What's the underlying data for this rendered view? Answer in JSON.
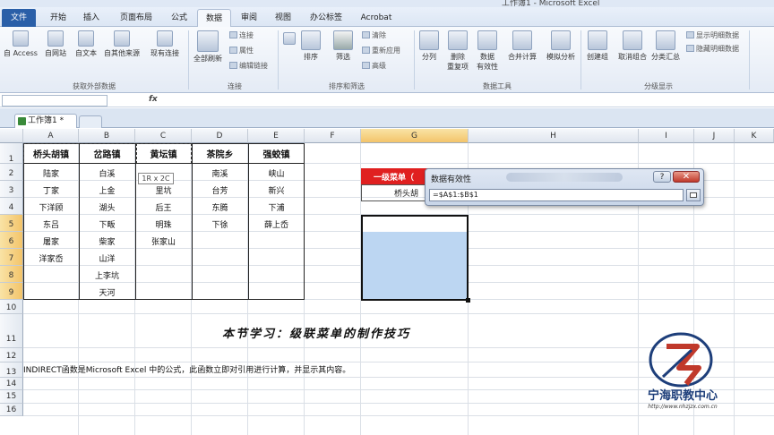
{
  "window": {
    "title": "工作簿1 - Microsoft Excel"
  },
  "tabs": [
    "文件",
    "开始",
    "插入",
    "页面布局",
    "公式",
    "数据",
    "审阅",
    "视图",
    "办公标签",
    "Acrobat"
  ],
  "ribbon": {
    "get_external": {
      "access": "自 Access",
      "web": "自网站",
      "text": "自文本",
      "other": "自其他来源",
      "existing": "现有连接",
      "label": "获取外部数据"
    },
    "connections": {
      "refresh_all": "全部刷新",
      "connections": "连接",
      "properties": "属性",
      "edit_links": "编辑链接",
      "label": "连接"
    },
    "sort_filter": {
      "sort_az": "A↓Z",
      "sort": "排序",
      "filter": "筛选",
      "clear": "清除",
      "reapply": "重新应用",
      "advanced": "高级",
      "label": "排序和筛选"
    },
    "data_tools": {
      "text_to_columns": "分列",
      "remove_dup_1": "删除",
      "remove_dup_2": "重复项",
      "validation_1": "数据",
      "validation_2": "有效性",
      "consolidate": "合并计算",
      "what_if": "模拟分析",
      "label": "数据工具"
    },
    "outline": {
      "group": "创建组",
      "ungroup": "取消组合",
      "subtotal": "分类汇总",
      "show_detail": "显示明细数据",
      "hide_detail": "隐藏明细数据",
      "label": "分级显示"
    }
  },
  "workbook_tab": "工作簿1 *",
  "formula_bar": {
    "fx": "fx",
    "name": ""
  },
  "columns": [
    "A",
    "B",
    "C",
    "D",
    "E",
    "F",
    "G",
    "H",
    "I",
    "J",
    "K"
  ],
  "rows": [
    "1",
    "2",
    "3",
    "4",
    "5",
    "6",
    "7",
    "8",
    "9",
    "10",
    "11",
    "12",
    "13",
    "14",
    "15",
    "16"
  ],
  "table": {
    "headers": [
      "桥头胡镇",
      "岔路镇",
      "黄坛镇",
      "茶院乡",
      "强蛟镇"
    ],
    "col_a": [
      "陆家",
      "丁家",
      "下洋顾",
      "东吕",
      "屠家",
      "洋家岙"
    ],
    "col_b": [
      "白溪",
      "上金",
      "湖头",
      "下畈",
      "柴家",
      "山洋",
      "上李坑",
      "天河"
    ],
    "col_c": [
      "",
      "里坑",
      "后王",
      "明珠",
      "张家山"
    ],
    "col_d": [
      "南溪",
      "台芳",
      "东腾",
      "下徐"
    ],
    "col_e": [
      "峡山",
      "新兴",
      "下浦",
      "薛上岙"
    ]
  },
  "menu_label": "一级菜单（",
  "g3_value": "桥头胡",
  "tooltip": "1R x 2C",
  "dialog": {
    "title": "数据有效性",
    "help": "?",
    "close": "✕",
    "formula": "=$A$1:$B$1"
  },
  "lesson": "本节学习：级联菜单的制作技巧",
  "note": "INDIRECT函数是Microsoft Excel 中的公式，此函数立即对引用进行计算，并显示其内容。",
  "logo": {
    "name": "宁海职教中心",
    "url": "http://www.nhzjzx.com.cn"
  },
  "colors": {
    "accent": "#2a5fa8",
    "menu_red": "#e02020",
    "selection": "#bcd6f2"
  }
}
